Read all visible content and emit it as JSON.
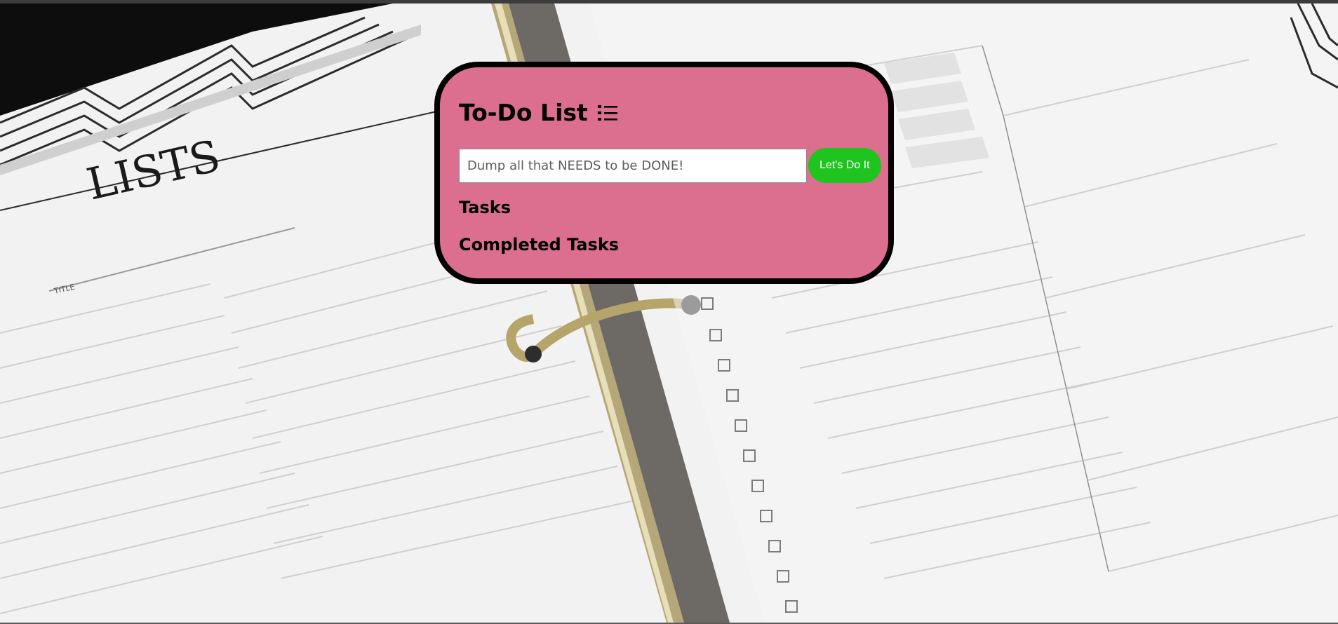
{
  "app": {
    "title": "To-Do List",
    "title_icon": "list-icon"
  },
  "input": {
    "value": "",
    "placeholder": "Dump all that NEEDS to be DONE!"
  },
  "buttons": {
    "submit_label": "Let's Do It"
  },
  "sections": {
    "tasks_heading": "Tasks",
    "completed_heading": "Completed Tasks"
  },
  "background": {
    "photo_heading": "LISTS",
    "photo_field_label": "TITLE"
  },
  "colors": {
    "card_background": "#dc6f8f",
    "card_border": "#000000",
    "button_background": "#1fc41f",
    "button_text": "#ffffff"
  },
  "icons": {
    "title": "list-icon"
  }
}
